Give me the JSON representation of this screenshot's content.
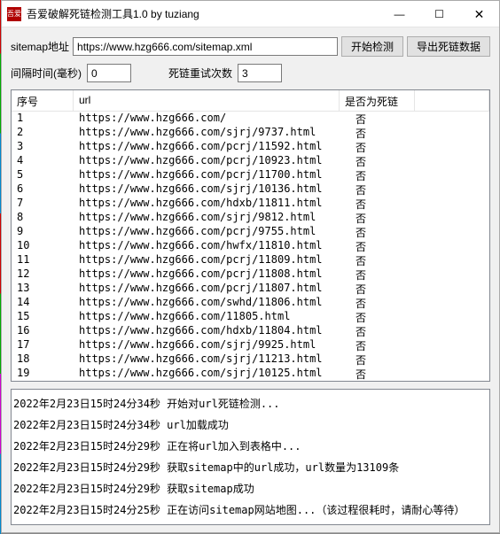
{
  "window": {
    "title": "吾爱破解死链检测工具1.0 by tuziang"
  },
  "labels": {
    "sitemap": "sitemap地址",
    "interval": "间隔时间(毫秒)",
    "retry": "死链重试次数"
  },
  "inputs": {
    "sitemap_url": "https://www.hzg666.com/sitemap.xml",
    "interval": "0",
    "retry": "3"
  },
  "buttons": {
    "start": "开始检测",
    "export": "导出死链数据"
  },
  "table": {
    "headers": {
      "index": "序号",
      "url": "url",
      "dead": "是否为死链"
    },
    "rows": [
      {
        "i": "1",
        "url": "https://www.hzg666.com/",
        "dead": "否"
      },
      {
        "i": "2",
        "url": "https://www.hzg666.com/sjrj/9737.html",
        "dead": "否"
      },
      {
        "i": "3",
        "url": "https://www.hzg666.com/pcrj/11592.html",
        "dead": "否"
      },
      {
        "i": "4",
        "url": "https://www.hzg666.com/pcrj/10923.html",
        "dead": "否"
      },
      {
        "i": "5",
        "url": "https://www.hzg666.com/pcrj/11700.html",
        "dead": "否"
      },
      {
        "i": "6",
        "url": "https://www.hzg666.com/sjrj/10136.html",
        "dead": "否"
      },
      {
        "i": "7",
        "url": "https://www.hzg666.com/hdxb/11811.html",
        "dead": "否"
      },
      {
        "i": "8",
        "url": "https://www.hzg666.com/sjrj/9812.html",
        "dead": "否"
      },
      {
        "i": "9",
        "url": "https://www.hzg666.com/pcrj/9755.html",
        "dead": "否"
      },
      {
        "i": "10",
        "url": "https://www.hzg666.com/hwfx/11810.html",
        "dead": "否"
      },
      {
        "i": "11",
        "url": "https://www.hzg666.com/pcrj/11809.html",
        "dead": "否"
      },
      {
        "i": "12",
        "url": "https://www.hzg666.com/pcrj/11808.html",
        "dead": "否"
      },
      {
        "i": "13",
        "url": "https://www.hzg666.com/pcrj/11807.html",
        "dead": "否"
      },
      {
        "i": "14",
        "url": "https://www.hzg666.com/swhd/11806.html",
        "dead": "否"
      },
      {
        "i": "15",
        "url": "https://www.hzg666.com/11805.html",
        "dead": "否"
      },
      {
        "i": "16",
        "url": "https://www.hzg666.com/hdxb/11804.html",
        "dead": "否"
      },
      {
        "i": "17",
        "url": "https://www.hzg666.com/sjrj/9925.html",
        "dead": "否"
      },
      {
        "i": "18",
        "url": "https://www.hzg666.com/sjrj/11213.html",
        "dead": "否"
      },
      {
        "i": "19",
        "url": "https://www.hzg666.com/sjrj/10125.html",
        "dead": "否"
      }
    ]
  },
  "log": [
    "2022年2月23日15时24分34秒   开始对url死链检测...",
    "2022年2月23日15时24分34秒   url加载成功",
    "2022年2月23日15时24分29秒   正在将url加入到表格中...",
    "2022年2月23日15时24分29秒   获取sitemap中的url成功，url数量为13109条",
    "2022年2月23日15时24分29秒   获取sitemap成功",
    "2022年2月23日15时24分25秒   正在访问sitemap网站地图...（该过程很耗时，请耐心等待）"
  ]
}
